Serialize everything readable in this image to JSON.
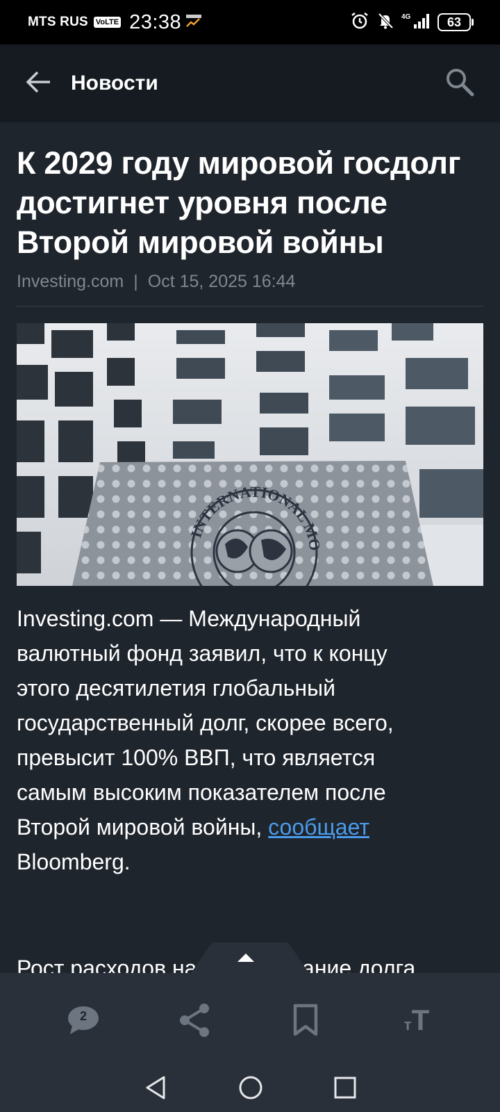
{
  "status_bar": {
    "carrier": "MTS RUS",
    "volte": "VoLTE",
    "time": "23:38",
    "network": "4G",
    "battery": "63"
  },
  "app_bar": {
    "title": "Новости",
    "back_icon": "arrow-left-icon",
    "search_icon": "search-icon"
  },
  "article": {
    "headline_lines": [
      "К 2029 году мировой госдолг",
      "достигнет уровня после",
      "Второй мировой войны"
    ],
    "source": "Investing.com",
    "separator": "|",
    "date": "Oct 15, 2025 16:44",
    "image_alt": "IMF building",
    "image_emblem_text": "INTERNATIONAL MONETARY FUND",
    "paragraph_1_lines": [
      "Investing.com — Международный",
      "валютный фонд заявил, что к концу",
      "этого десятилетия глобальный",
      "государственный долг, скорее всего,",
      "превысит 100% ВВП, что является",
      "самым высоким показателем после",
      "Второй мировой войны, "
    ],
    "paragraph_1_link": "сообщает",
    "paragraph_1_end": "Bloomberg.",
    "paragraph_2_partial": "Рост расходов на обслуживание долга"
  },
  "toolbar": {
    "comment_count": "2",
    "comment_icon": "comment-icon",
    "share_icon": "share-icon",
    "bookmark_icon": "bookmark-icon",
    "font_size_icon": "font-size-icon",
    "expand_icon": "chevron-up-icon"
  },
  "nav_bar": {
    "back": "nav-back-icon",
    "home": "nav-home-icon",
    "recents": "nav-recents-icon"
  },
  "colors": {
    "background": "#1f252d",
    "app_bar": "#161b21",
    "toolbar": "#2a3039",
    "link": "#4a9bea",
    "meta": "#7f8790"
  }
}
